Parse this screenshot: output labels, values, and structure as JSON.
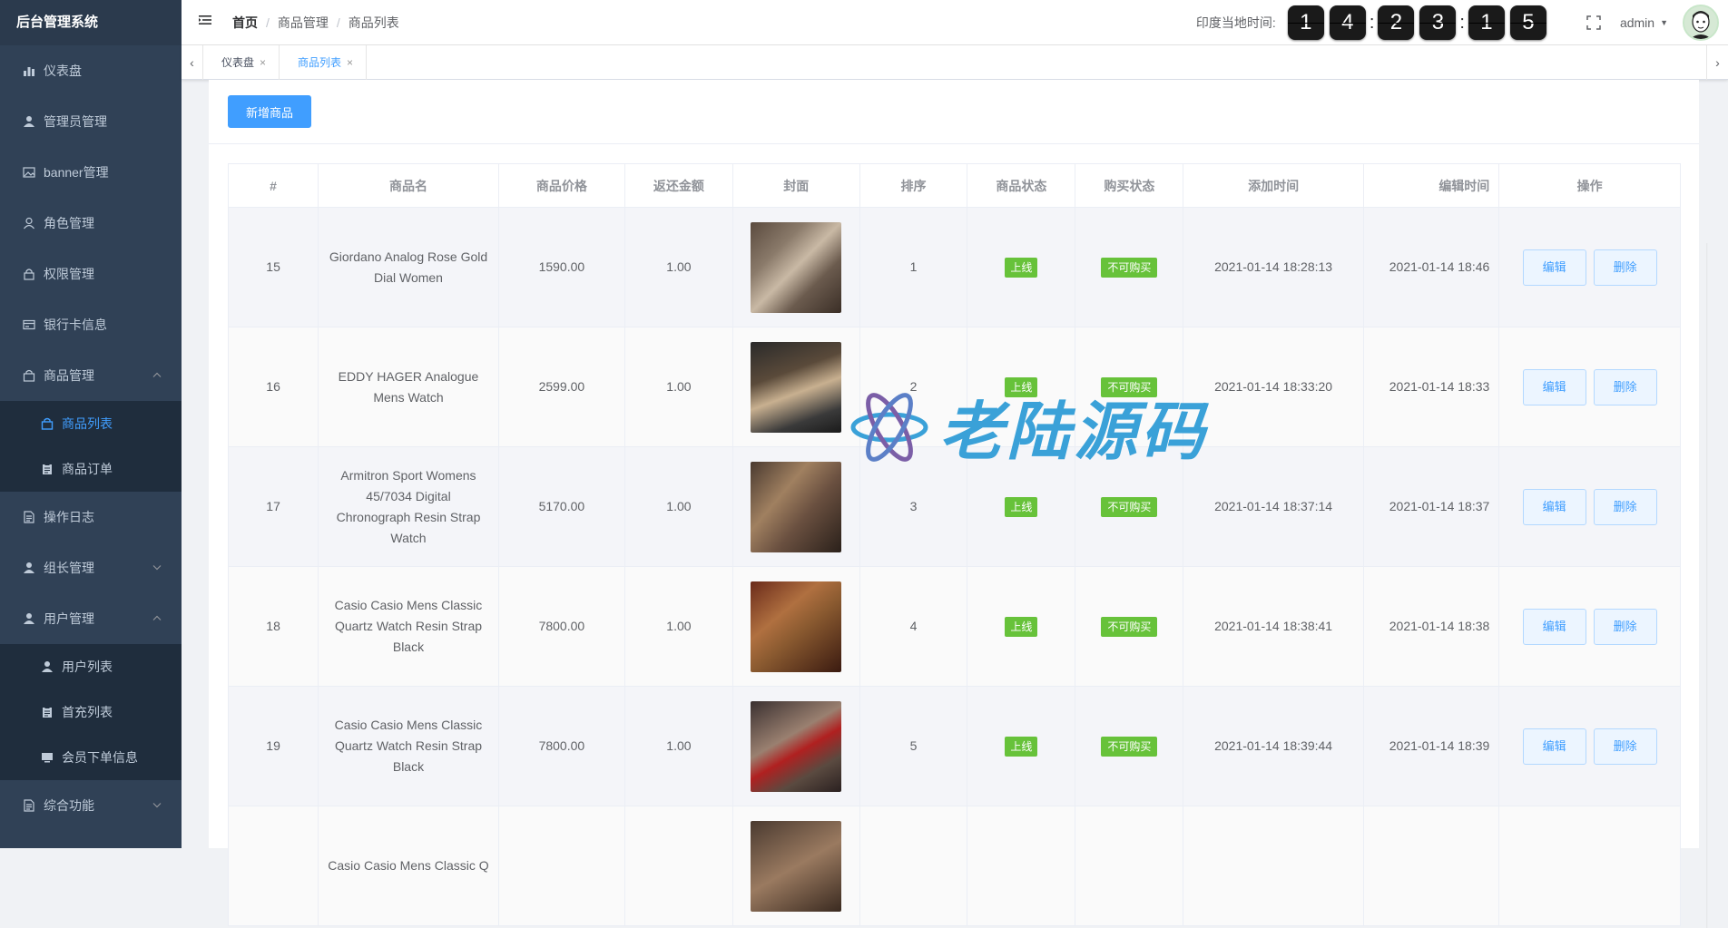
{
  "app": {
    "title": "后台管理系统"
  },
  "sidebar": {
    "items": [
      {
        "label": "仪表盘",
        "icon": "dashboard-icon"
      },
      {
        "label": "管理员管理",
        "icon": "user-icon"
      },
      {
        "label": "banner管理",
        "icon": "image-icon"
      },
      {
        "label": "角色管理",
        "icon": "person-icon"
      },
      {
        "label": "权限管理",
        "icon": "lock-icon"
      },
      {
        "label": "银行卡信息",
        "icon": "card-icon"
      },
      {
        "label": "商品管理",
        "icon": "shop-icon",
        "expanded": true,
        "children": [
          {
            "label": "商品列表",
            "icon": "bag-icon",
            "active": true
          },
          {
            "label": "商品订单",
            "icon": "clipboard-icon"
          }
        ]
      },
      {
        "label": "操作日志",
        "icon": "log-icon"
      },
      {
        "label": "组长管理",
        "icon": "user-icon",
        "expanded": false
      },
      {
        "label": "用户管理",
        "icon": "user-icon",
        "expanded": true,
        "children": [
          {
            "label": "用户列表",
            "icon": "user-icon"
          },
          {
            "label": "首充列表",
            "icon": "clipboard-icon"
          },
          {
            "label": "会员下单信息",
            "icon": "monitor-icon"
          }
        ]
      },
      {
        "label": "综合功能",
        "icon": "log-icon",
        "expanded": false
      }
    ]
  },
  "navbar": {
    "breadcrumb": [
      "首页",
      "商品管理",
      "商品列表"
    ],
    "time_label": "印度当地时间:",
    "time_digits": [
      "1",
      "4",
      "2",
      "3",
      "1",
      "5"
    ],
    "colon": ":",
    "user": "admin"
  },
  "tags": [
    {
      "label": "仪表盘",
      "active": false
    },
    {
      "label": "商品列表",
      "active": true
    }
  ],
  "toolbar": {
    "add_label": "新增商品"
  },
  "table": {
    "headers": [
      "#",
      "商品名",
      "商品价格",
      "返还金额",
      "封面",
      "排序",
      "商品状态",
      "购买状态",
      "添加时间",
      "编辑时间",
      "操作"
    ],
    "rows": [
      {
        "id": "15",
        "name": "Giordano Analog Rose Gold Dial Women",
        "price": "1590.00",
        "rebate": "1.00",
        "sort": "1",
        "status": "上线",
        "buy": "不可购买",
        "added": "2021-01-14 18:28:13",
        "edited": "2021-01-14 18:46"
      },
      {
        "id": "16",
        "name": "EDDY HAGER Analogue Mens Watch",
        "price": "2599.00",
        "rebate": "1.00",
        "sort": "2",
        "status": "上线",
        "buy": "不可购买",
        "added": "2021-01-14 18:33:20",
        "edited": "2021-01-14 18:33"
      },
      {
        "id": "17",
        "name": "Armitron Sport Womens 45/7034 Digital Chronograph Resin Strap Watch",
        "price": "5170.00",
        "rebate": "1.00",
        "sort": "3",
        "status": "上线",
        "buy": "不可购买",
        "added": "2021-01-14 18:37:14",
        "edited": "2021-01-14 18:37"
      },
      {
        "id": "18",
        "name": "Casio Casio Mens Classic Quartz Watch Resin Strap Black",
        "price": "7800.00",
        "rebate": "1.00",
        "sort": "4",
        "status": "上线",
        "buy": "不可购买",
        "added": "2021-01-14 18:38:41",
        "edited": "2021-01-14 18:38"
      },
      {
        "id": "19",
        "name": "Casio Casio Mens Classic Quartz Watch Resin Strap Black",
        "price": "7800.00",
        "rebate": "1.00",
        "sort": "5",
        "status": "上线",
        "buy": "不可购买",
        "added": "2021-01-14 18:39:44",
        "edited": "2021-01-14 18:39"
      },
      {
        "id": "",
        "name": "Casio Casio Mens Classic Q",
        "price": "",
        "rebate": "",
        "sort": "",
        "status": "",
        "buy": "",
        "added": "",
        "edited": ""
      }
    ],
    "edit_label": "编辑",
    "delete_label": "删除"
  },
  "watermark": {
    "text": "老陆源码"
  },
  "colors": {
    "sidebar_bg": "#304156",
    "primary": "#409eff",
    "success": "#67c23a"
  }
}
